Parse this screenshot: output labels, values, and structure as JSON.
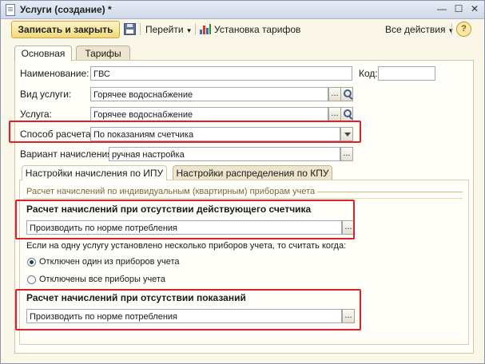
{
  "window": {
    "title": "Услуги (создание) *",
    "minimize_glyph": "—",
    "maximize_glyph": "☐",
    "close_glyph": "✕"
  },
  "toolbar": {
    "save_close_label": "Записать и закрыть",
    "navigate_label": "Перейти",
    "tariffs_label": "Установка тарифов",
    "all_actions_label": "Все действия",
    "help_glyph": "?"
  },
  "main_tabs": [
    {
      "label": "Основная",
      "active": true
    },
    {
      "label": "Тарифы",
      "active": false
    }
  ],
  "fields": {
    "name_label": "Наименование:",
    "name_value": "ГВС",
    "code_label": "Код:",
    "code_value": "",
    "service_type_label": "Вид услуги:",
    "service_type_value": "Горячее водоснабжение",
    "service_label": "Услуга:",
    "service_value": "Горячее водоснабжение",
    "calc_method_label": "Способ расчета:",
    "calc_method_value": "По показаниям счетчика",
    "accrual_variant_label": "Вариант начисления:",
    "accrual_variant_value": "ручная настройка"
  },
  "inner_tabs": [
    {
      "label": "Настройки начисления по ИПУ",
      "active": true
    },
    {
      "label": "Настройки распределения по КПУ",
      "active": false
    }
  ],
  "ipu": {
    "group_caption": "Расчет начислений по индивидуальным (квартирным) приборам учета",
    "no_meter_heading": "Расчет начислений при отсутствии действующего счетчика",
    "no_meter_value": "Производить по норме потребления",
    "multi_meter_question": "Если на одну услугу установлено несколько приборов учета, то считать когда:",
    "radio_options": [
      {
        "label": "Отключен один из приборов учета",
        "checked": true
      },
      {
        "label": "Отключены все приборы учета",
        "checked": false
      }
    ],
    "no_readings_heading": "Расчет начислений при отсутствии показаний",
    "no_readings_value": "Производить по норме потребления"
  },
  "icons": {
    "title": "document-icon",
    "save": "floppy-disk-icon",
    "tariffs": "bar-chart-icon",
    "help": "help-icon",
    "search": "magnifier-icon",
    "select": "ellipsis-icon",
    "dropdown": "chevron-down-icon"
  },
  "ellipsis": "...",
  "colors": {
    "highlight_red": "#e0202a",
    "primary_button": "#f1d97a",
    "window_bg": "#fbf7e8"
  }
}
